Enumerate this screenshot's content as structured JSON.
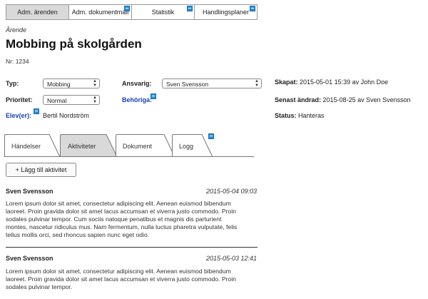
{
  "nav": {
    "tabs": [
      {
        "label": "Adm. ärenden"
      },
      {
        "label": "Adm. dokumentmall"
      },
      {
        "label": "Statistik"
      },
      {
        "label": "Handlingsplaner"
      }
    ]
  },
  "case": {
    "breadcrumb": "Ärende",
    "title": "Mobbing på skolgården",
    "number": "Nr: 1234"
  },
  "form": {
    "typ_label": "Typ:",
    "typ_value": "Mobbing",
    "prioritet_label": "Prioritet:",
    "prioritet_value": "Normal",
    "elever_label": "Elev(er):",
    "elever_value": "Bertil Nordström",
    "ansvarig_label": "Ansvarig:",
    "ansvarig_value": "Sven Svensson",
    "behoriga_label": "Behöriga:"
  },
  "meta": {
    "skapat_label": "Skapat:",
    "skapat_value": "2015-05-01 15:39 av John Doe",
    "andrad_label": "Senast ändrad:",
    "andrad_value": "2015-08-25 av Sven Svensson",
    "status_label": "Status:",
    "status_value": "Hanteras"
  },
  "tabs": [
    {
      "label": "Händelser"
    },
    {
      "label": "Aktiviteter"
    },
    {
      "label": "Dokument"
    },
    {
      "label": "Logg"
    }
  ],
  "add_activity_label": "+ Lägg till aktivitet",
  "entries": [
    {
      "author": "Sven Svensson",
      "time": "2015-05-04 09:03",
      "lines": [
        "Lorem ipsum dolor sit amet, consectetur adipiscing elit. Aenean euismod bibendum",
        "laoreet. Proin gravida dolor sit amet lacus accumsan et viverra justo commodo. Proin",
        "sodales pulvinar tempor. Cum sociis natoque penatibus et magnis dis parturient",
        "montes, nascetur ridiculus mus. Nam fermentum, nulla luctus pharetra vulputate, felis",
        "tellus mollis orci, sed rhoncus sapien nunc eget odio."
      ]
    },
    {
      "author": "Sven Svensson",
      "time": "2015-05-03 12:41",
      "lines": [
        "Lorem ipsum dolor sit amet, consectetur adipiscing elit. Aenean euismod bibendum",
        "laoreet. Proin gravida dolor sit amet lacus accumsan et viverra justo commodo. Proin",
        "sodales pulvinar tempor."
      ]
    }
  ],
  "colors": {
    "accent_blue": "#2a8fd6",
    "link_blue": "#1a3fb8",
    "active_tab": "#d9d9d9"
  }
}
